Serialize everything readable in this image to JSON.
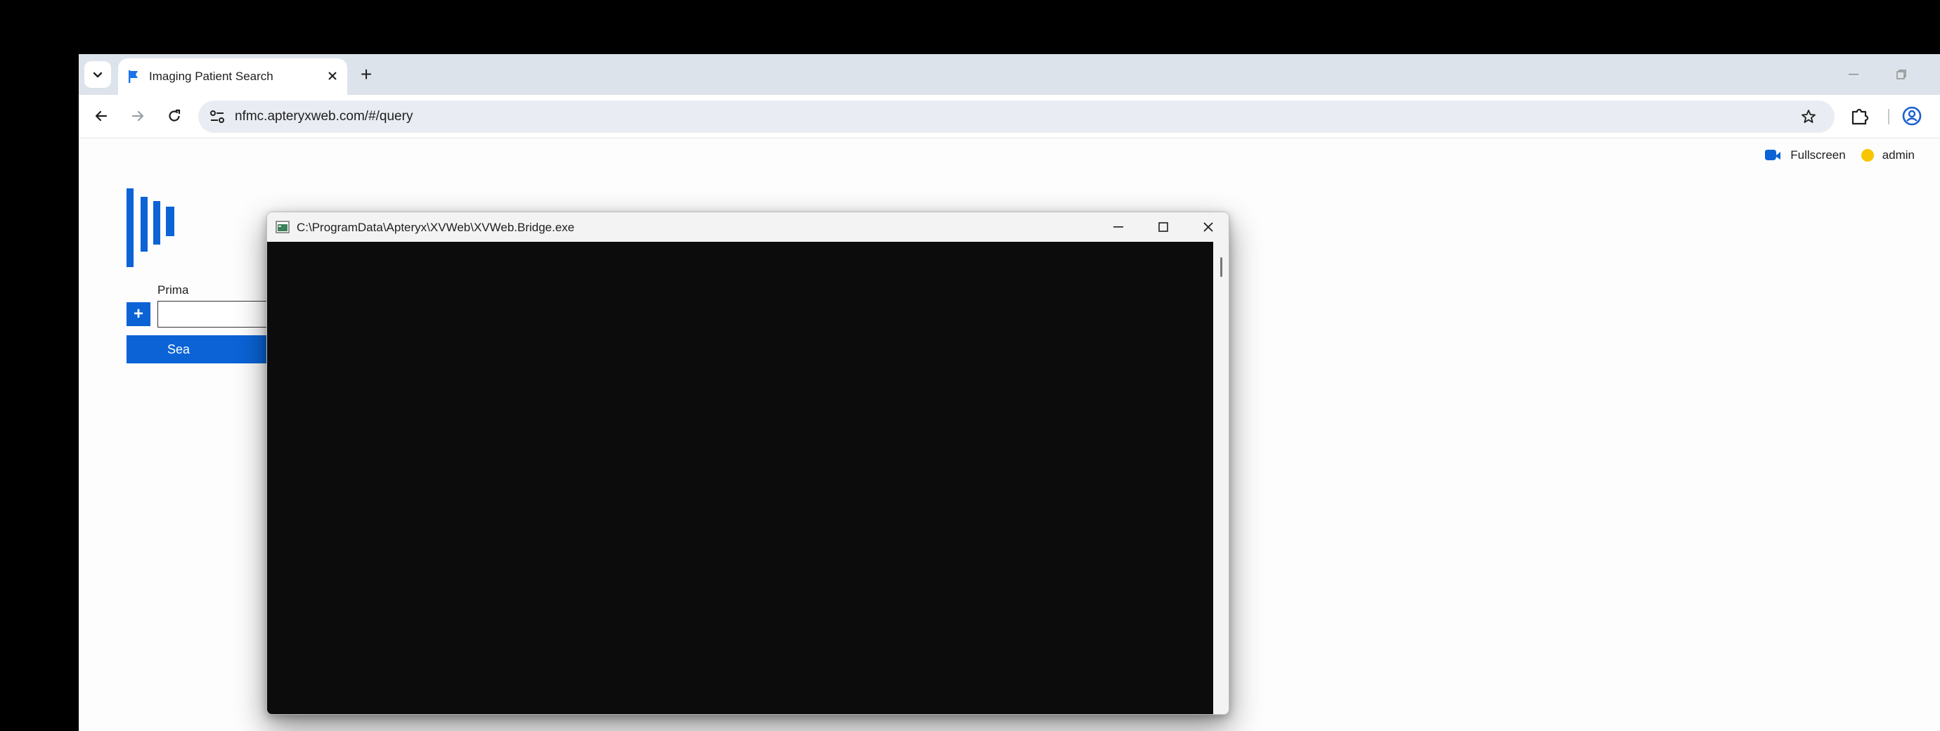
{
  "browser": {
    "tab": {
      "title": "Imaging Patient Search"
    },
    "new_tab_label": "+",
    "address": {
      "url": "nfmc.apteryxweb.com/#/query"
    },
    "icons": {
      "tab_search": "chevron-down-icon",
      "back": "arrow-left-icon",
      "forward": "arrow-right-icon",
      "reload": "reload-icon",
      "bookmark": "star-icon",
      "extensions": "puzzle-icon",
      "profile": "account-icon"
    }
  },
  "page": {
    "header": {
      "fullscreen_label": "Fullscreen",
      "user_label": "admin"
    },
    "search_form": {
      "field_label": "Prima",
      "add_button_label": "+",
      "primary_value": "",
      "search_button_label": "Sea"
    },
    "colors": {
      "accent": "#0b63d6",
      "user_status": "#f7c600"
    }
  },
  "console_window": {
    "title": "C:\\ProgramData\\Apteryx\\XVWeb\\XVWeb.Bridge.exe",
    "background": "#0c0c0c"
  }
}
